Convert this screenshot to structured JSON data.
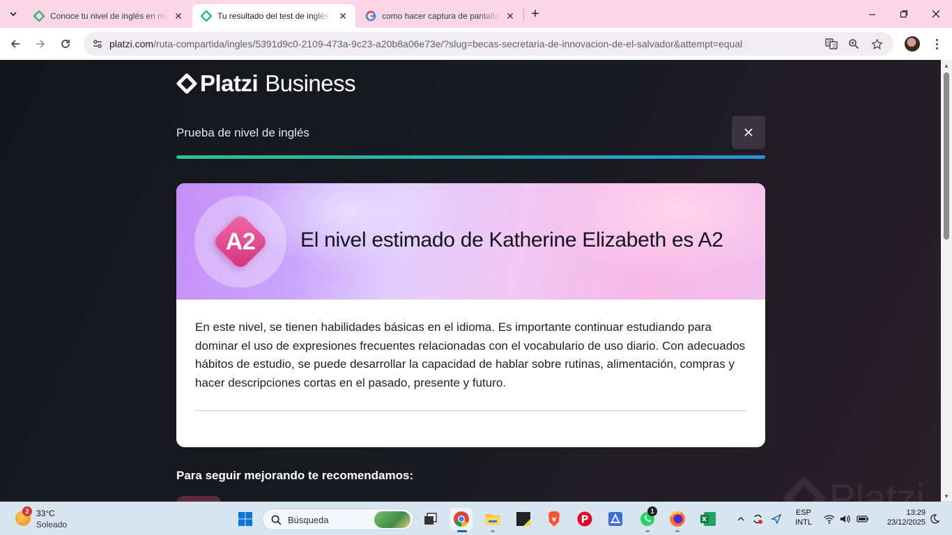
{
  "browser": {
    "tabs": [
      {
        "title": "Conoce tu nivel de inglés en minutos",
        "active": false
      },
      {
        "title": "Tu resultado del test de inglés en Platzi",
        "active": true
      },
      {
        "title": "como hacer captura de pantalla",
        "active": false
      }
    ],
    "url_host": "platzi.com",
    "url_rest": "/ruta-compartida/ingles/5391d9c0-2109-473a-9c23-a20b8a06e73e/?slug=becas-secretaria-de-innovacion-de-el-salvador&attempt=equal"
  },
  "page": {
    "logo_brand": "Platzi",
    "logo_sub": "Business",
    "test_title": "Prueba de nivel de inglés",
    "progress_fraction": 1.0,
    "result": {
      "level": "A2",
      "title": "El nivel estimado de Katherine Elizabeth es A2",
      "description": "En este nivel, se tienen habilidades básicas en el idioma. Es importante continuar estudiando para dominar el uso de expresiones frecuentes relacionadas con el vocabulario de uso diario. Con adecuados hábitos de estudio, se puede desarrollar la capacidad de hablar sobre rutinas, alimentación, compras y hacer descripciones cortas en el pasado, presente y futuro."
    },
    "recommend_heading": "Para seguir mejorando te recomendamos:",
    "watermark": "Platzi"
  },
  "taskbar": {
    "weather_temp": "33°C",
    "weather_desc": "Soleado",
    "weather_badge": "2",
    "search_placeholder": "Búsqueda",
    "whatsapp_badge": "1",
    "lang_top": "ESP",
    "lang_bottom": "INTL",
    "time": "13:29",
    "date": "23/12/2025"
  },
  "colors": {
    "accent_green": "#2dc48a",
    "accent_blue": "#2a8fd9",
    "badge_pink": "#d2337c"
  }
}
